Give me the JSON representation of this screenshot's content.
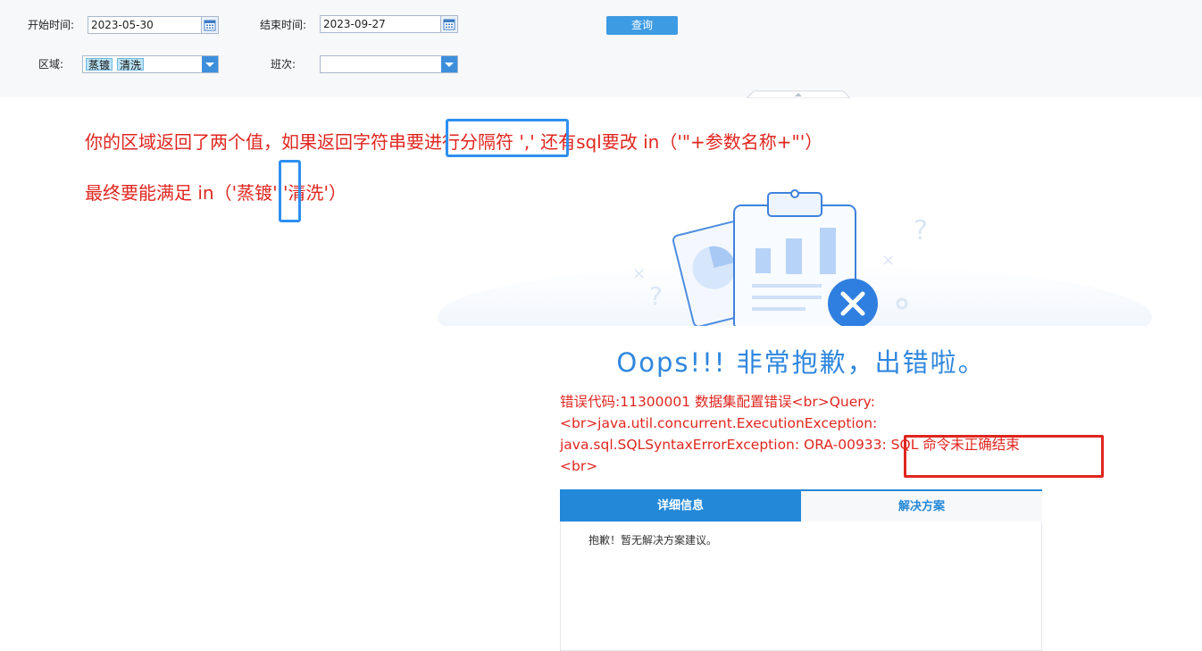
{
  "filters": {
    "start_label": "开始时间:",
    "start_value": "2023-05-30",
    "end_label": "结束时间:",
    "end_value": "2023-09-27",
    "query_label": "查询",
    "area_label": "区域:",
    "area_tags": [
      "蒸镀",
      "清洗"
    ],
    "shift_label": "班次:",
    "shift_value": ""
  },
  "annotations": {
    "line1": "你的区域返回了两个值，如果返回字符串要进行分隔符   ',' 还有sql要改  in（'\"+参数名称+\"'）",
    "line2": "最终要能满足 in（'蒸镀','清洗'）"
  },
  "error": {
    "title": "Oops!!! 非常抱歉，出错啦。",
    "message": "错误代码:11300001 数据集配置错误<br>Query: <br>java.util.concurrent.ExecutionException: java.sql.SQLSyntaxErrorException: ORA-00933: SQL 命令未正确结束<br>",
    "tabs": [
      "详细信息",
      "解决方案"
    ],
    "solution_text": "抱歉！暂无解决方案建议。"
  },
  "colors": {
    "accent": "#2388d8",
    "annotation_red": "#e0261f",
    "oops_blue": "#2f87de"
  }
}
